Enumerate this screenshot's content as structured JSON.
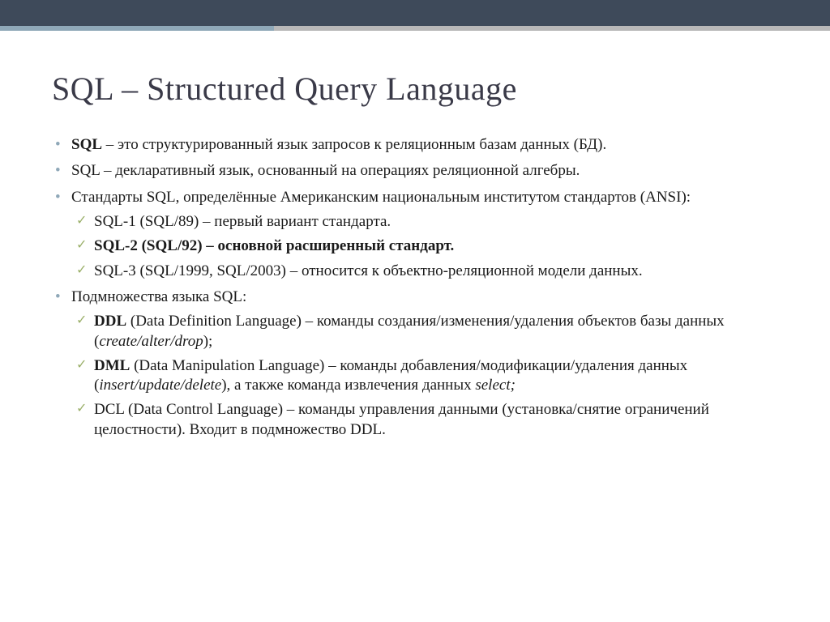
{
  "title": "SQL – Structured Query Language",
  "bullets": [
    {
      "bold": "SQL",
      "rest": " – это структурированный язык запросов к реляционным базам данных (БД)."
    },
    {
      "text": "SQL – декларативный язык, основанный на операциях реляционной алгебры."
    },
    {
      "text": "Стандарты SQL, определённые Американским национальным институтом стандартов (ANSI):",
      "sub": [
        {
          "text": "SQL-1 (SQL/89) – первый вариант стандарта."
        },
        {
          "text": "SQL-2 (SQL/92) – основной расширенный стандарт."
        },
        {
          "text": "SQL-3 (SQL/1999, SQL/2003) – относится к объектно-реляционной модели данных."
        }
      ]
    },
    {
      "text": "Подмножества языка SQL:",
      "sub": [
        {
          "bold": "DDL",
          "mid": " (Data Definition Language) – команды создания/изменения/удаления объектов базы данных (",
          "italic": "create/alter/drop",
          "tail": ");"
        },
        {
          "bold": "DML",
          "mid": " (Data Manipulation Language) – команды добавления/модификации/удаления данных (",
          "italic": "insert/update/delete",
          "mid2": "), а также команда извлечения данных ",
          "italic2": "select;"
        },
        {
          "text": "DCL (Data Control Language) – команды управления данными (установка/снятие ограничений целостности). Входит в подмножество DDL."
        }
      ]
    }
  ]
}
